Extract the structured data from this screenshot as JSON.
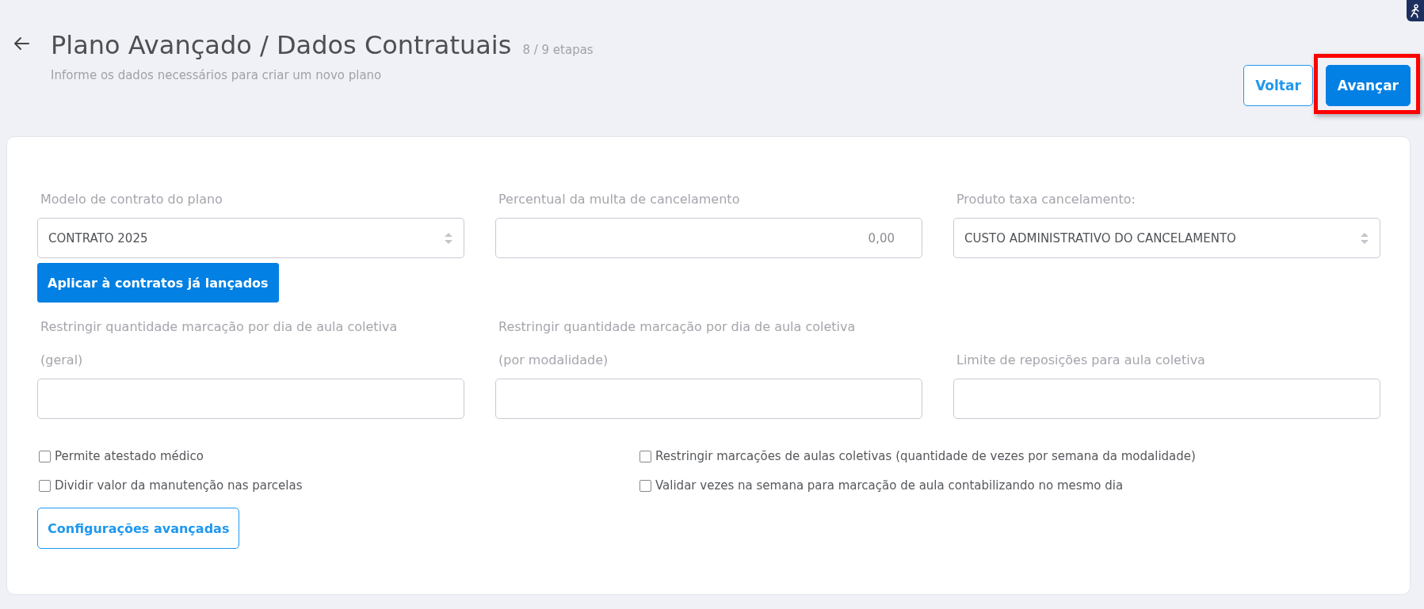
{
  "header": {
    "title": "Plano Avançado / Dados Contratuais",
    "steps": "8 / 9 etapas",
    "subtitle": "Informe os dados necessários para criar um novo plano"
  },
  "actions": [
    {
      "label": "Voltar",
      "kind": "outline",
      "highlighted": false
    },
    {
      "label": "Avançar",
      "kind": "primary",
      "highlighted": true
    }
  ],
  "fields": [
    {
      "label_lines": [
        "Modelo de contrato do plano"
      ],
      "kind": "select",
      "value": "CONTRATO 2025"
    },
    {
      "label_lines": [
        "Percentual da multa de cancelamento"
      ],
      "kind": "number",
      "value": "0,00"
    },
    {
      "label_lines": [
        "Produto taxa cancelamento:"
      ],
      "kind": "select",
      "value": "CUSTO ADMINISTRATIVO DO CANCELAMENTO"
    },
    {
      "kind": "button",
      "label": "Aplicar à contratos já lançados"
    },
    {
      "label_lines": [
        "Restringir quantidade marcação por dia de aula coletiva",
        "(geral)"
      ],
      "kind": "text"
    },
    {
      "label_lines": [
        "Restringir quantidade marcação por dia de aula coletiva",
        "(por modalidade)"
      ],
      "kind": "text"
    },
    {
      "label_lines": [
        "Limite de reposições para aula coletiva"
      ],
      "kind": "text"
    }
  ],
  "checkboxes_left": [
    {
      "label": "Permite atestado médico",
      "checked": false
    },
    {
      "label": "Dividir valor da manutenção nas parcelas",
      "checked": false
    }
  ],
  "checkboxes_right": [
    {
      "label": "Restringir marcações de aulas coletivas (quantidade de vezes por semana da modalidade)",
      "checked": false
    },
    {
      "label": "Validar vezes na semana para marcação de aula contabilizando no mesmo dia",
      "checked": false
    }
  ],
  "advanced_button": "Configurações avançadas"
}
